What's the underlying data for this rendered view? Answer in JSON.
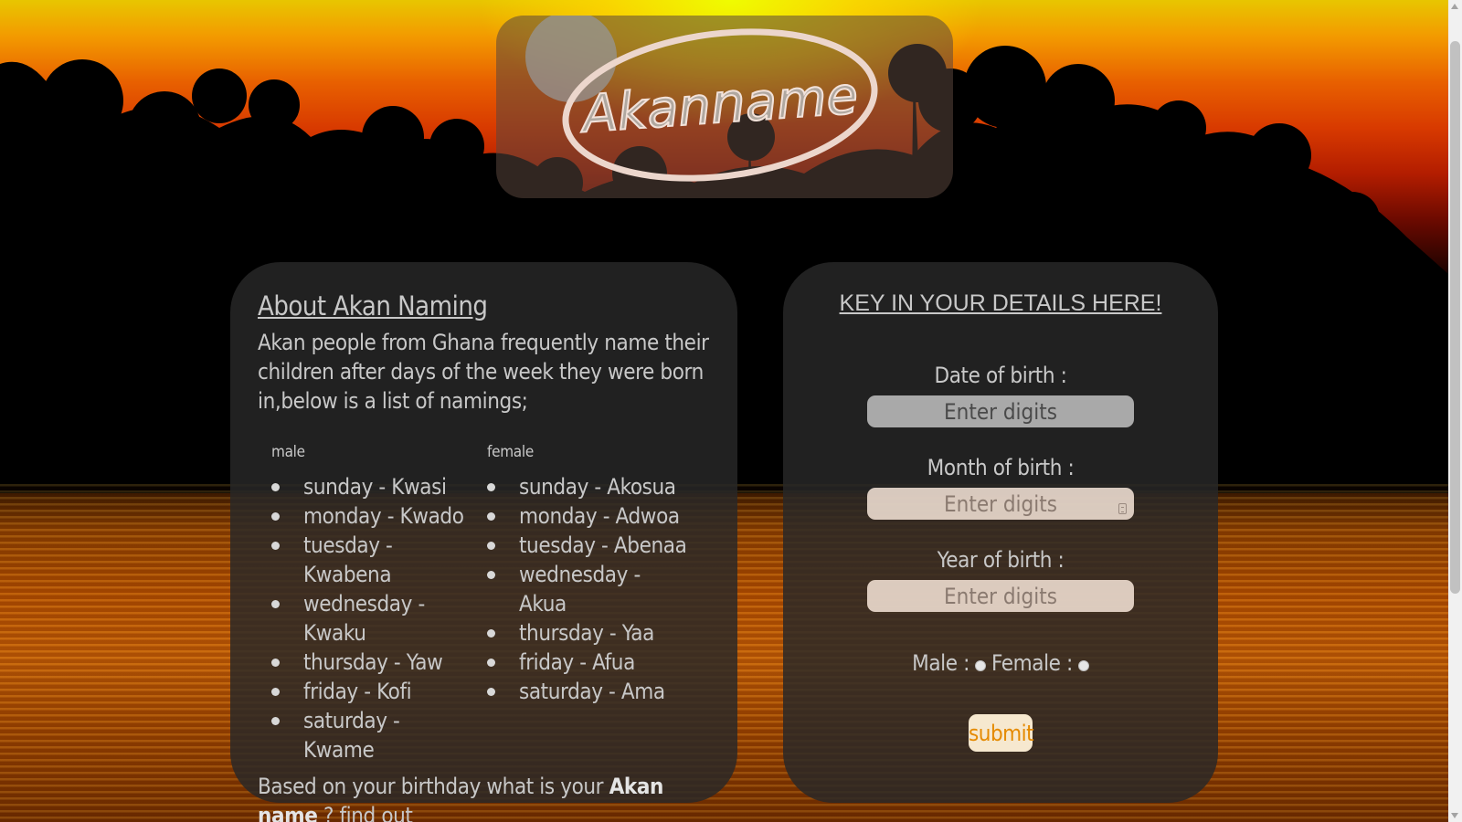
{
  "logo": {
    "text_part1": "Akan",
    "text_part2": "ame",
    "letter_n": "n"
  },
  "about": {
    "title": "About Akan Naming",
    "intro": "Akan people from Ghana frequently name their children after days of the week they were born in,below is a list of namings;",
    "male_heading": "male",
    "female_heading": "female",
    "male_names": [
      "sunday - Kwasi",
      "monday - Kwado",
      "tuesday - Kwabena",
      "wednesday - Kwaku",
      "thursday - Yaw",
      "friday - Kofi",
      "saturday - Kwame"
    ],
    "female_names": [
      "sunday - Akosua",
      "monday - Adwoa",
      "tuesday - Abenaa",
      "wednesday - Akua",
      "thursday - Yaa",
      "friday - Afua",
      "saturday - Ama"
    ],
    "outro_before": "Based on your birthday what is your ",
    "outro_bold": "Akan name",
    "outro_after": " ? find out"
  },
  "form": {
    "title": "KEY IN YOUR DETAILS HERE!",
    "date_label": "Date of birth :",
    "date_placeholder": "Enter digits",
    "month_label": "Month of birth :",
    "month_placeholder": "Enter digits",
    "year_label": "Year of birth :",
    "year_placeholder": "Enter digits",
    "male_label": "Male :",
    "female_label": "Female :",
    "submit_label": "submit"
  },
  "colors": {
    "panel_bg": "#282828",
    "text": "#c8c8c8",
    "submit_text": "#e58a00",
    "submit_bg": "#f6e8cf"
  }
}
